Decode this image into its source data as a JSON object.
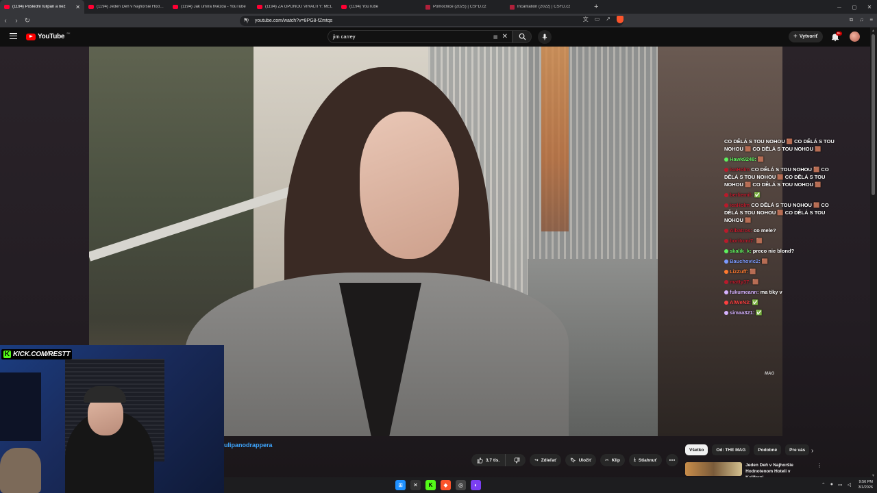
{
  "browser": {
    "tabs": [
      {
        "title": "(1194) Poslední tulipán a než",
        "type": "yt",
        "active": true
      },
      {
        "title": "(1194) Jeden Deň v Najhoršie Hodnot",
        "type": "yt"
      },
      {
        "title": "(1194) Jak umírá hvězda - YouTube",
        "type": "yt"
      },
      {
        "title": "(1194) ZA OPONOU VIRALITY: MEL",
        "type": "yt"
      },
      {
        "title": "(1194) YouTube",
        "type": "yt"
      },
      {
        "title": "Pomocnice (2025) | ČSFD.cz",
        "type": "csfd"
      },
      {
        "title": "Incantation (2022) | ČSFD.cz",
        "type": "csfd"
      }
    ],
    "url": "youtube.com/watch?v=8PG8-fZmtqs"
  },
  "youtube": {
    "logo_text": "YouTube",
    "logo_country": "SK",
    "search_query": "jim carrey",
    "create_label": "Vytvoriť",
    "notification_count": "9+",
    "channel_name": "ulipanodrappera",
    "actions": {
      "like_count": "3,7 tis.",
      "share": "Zdieľať",
      "save": "Uložiť",
      "clip": "Klip",
      "download": "Stiahnuť"
    },
    "chips": [
      "Všetko",
      "Od: THE MAG",
      "Podobné",
      "Pre vás"
    ],
    "recommendation": {
      "title": "Jeden Deň v Najhoršie Hodnotenom Hoteli v Kaliforni..."
    },
    "video_watermark": "MAG"
  },
  "chat": [
    {
      "user": "",
      "text": "CO DĚLÁ S TOU NOHOU 🟫 CO DĚLÁ S TOU NOHOU 🟫 CO DĚLÁ S TOU NOHOU 🟫",
      "color": "#ffffff"
    },
    {
      "user": "Hawk9248:",
      "text": "🟫",
      "color": "#5ef05e"
    },
    {
      "user": "icaHolm",
      "text": "CO DĚLÁ S TOU NOHOU 🟫 CO DĚLÁ S TOU NOHOU 🟫 CO DĚLÁ S TOU NOHOU 🟫 CO DĚLÁ S TOU NOHOU 🟫",
      "color": "#b91a2b"
    },
    {
      "user": "berliemil:",
      "text": "✅",
      "color": "#b91a2b"
    },
    {
      "user": "icaHolm",
      "text": "CO DĚLÁ S TOU NOHOU 🟫 CO DĚLÁ S TOU NOHOU 🟫 CO DĚLÁ S TOU NOHOU 🟫",
      "color": "#b91a2b"
    },
    {
      "user": "Albatros:",
      "text": "co mele?",
      "color": "#b91a2b"
    },
    {
      "user": "boritomi7:",
      "text": "🟫",
      "color": "#b91a2b"
    },
    {
      "user": "skalik_k:",
      "text": "preco nie blond?",
      "color": "#5ef05e"
    },
    {
      "user": "Bauchovic2:",
      "text": "🟫",
      "color": "#7b9bff"
    },
    {
      "user": "LizZuff:",
      "text": "🟫",
      "color": "#ff7a2f"
    },
    {
      "user": "matty37:",
      "text": "🟫",
      "color": "#b91a2b"
    },
    {
      "user": "fukumeann:",
      "text": "ma tiky v",
      "color": "#d6b3ff"
    },
    {
      "user": "AlWeN3:",
      "text": "✅",
      "color": "#ff4040"
    },
    {
      "user": "simaa321:",
      "text": "✅",
      "color": "#d6b3ff"
    }
  ],
  "stream_overlay": {
    "kick_url": "KICK.COM/RESTT"
  },
  "taskbar": {
    "time": "9:56 PM",
    "date": "3/1/2026"
  }
}
